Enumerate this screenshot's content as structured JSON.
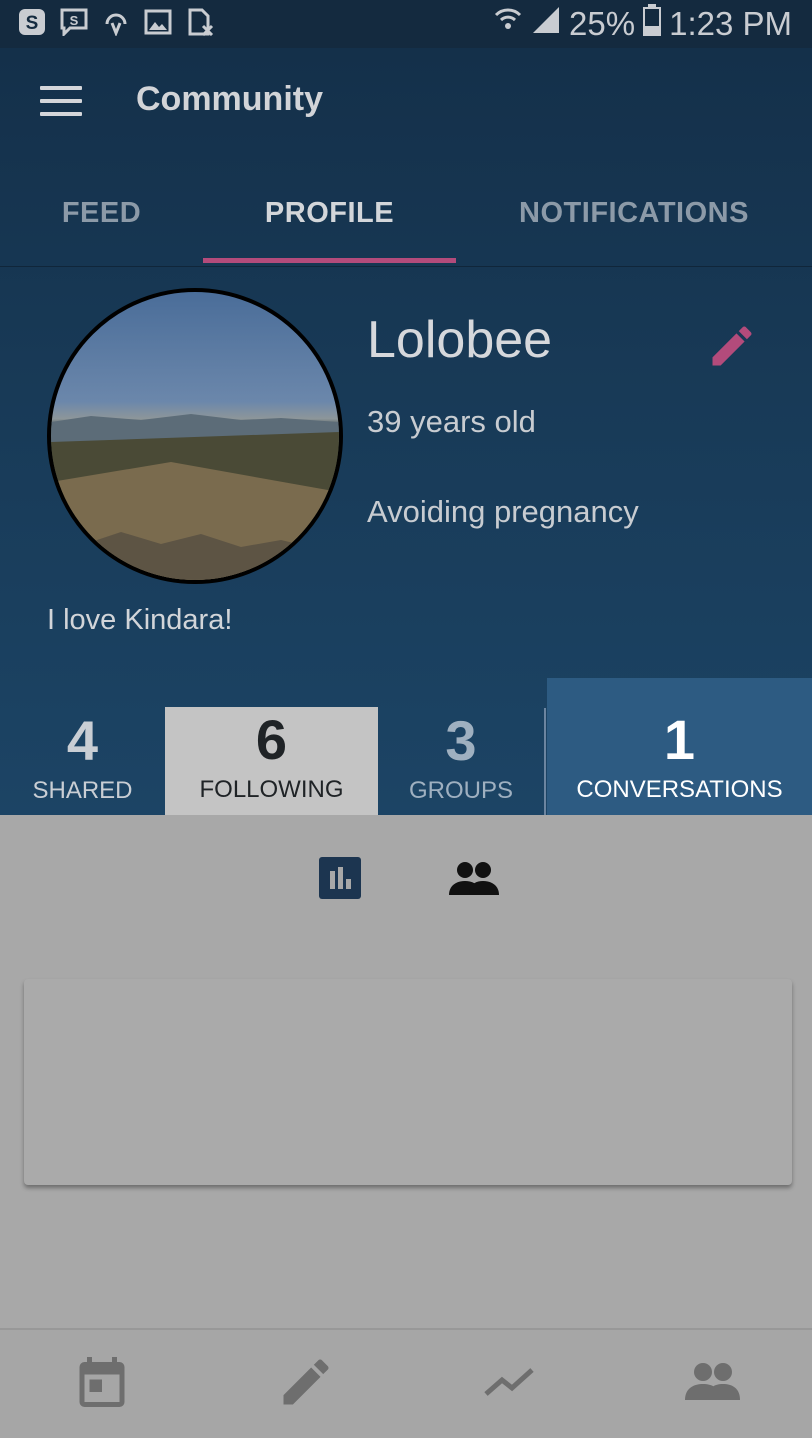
{
  "status_bar": {
    "battery": "25%",
    "time": "1:23 PM",
    "icons": [
      "skype-icon",
      "skype-message-icon",
      "sync-icon",
      "image-icon",
      "sim-card-icon",
      "wifi-icon",
      "signal-icon",
      "battery-icon"
    ]
  },
  "header": {
    "title": "Community"
  },
  "tabs": [
    {
      "label": "FEED"
    },
    {
      "label": "PROFILE"
    },
    {
      "label": "NOTIFICATIONS"
    }
  ],
  "active_tab": "PROFILE",
  "profile": {
    "username": "Lolobee",
    "age": "39 years old",
    "goal": "Avoiding pregnancy",
    "bio": "I love Kindara!"
  },
  "stats": [
    {
      "count": "4",
      "label": "SHARED"
    },
    {
      "count": "6",
      "label": "FOLLOWING"
    },
    {
      "count": "3",
      "label": "GROUPS"
    },
    {
      "count": "1",
      "label": "CONVERSATIONS"
    }
  ],
  "view_toggle": {
    "icons": [
      "bar-chart-icon",
      "people-icon"
    ],
    "selected": "bar-chart-icon"
  },
  "bottom_nav": {
    "icons": [
      "calendar-icon",
      "pencil-icon",
      "trend-icon",
      "people-icon"
    ]
  },
  "colors": {
    "header_bg": "#142a3f",
    "accent": "#b34b7b",
    "conversations_bg": "#2d5b82",
    "content_bg": "#a8a8a8"
  }
}
